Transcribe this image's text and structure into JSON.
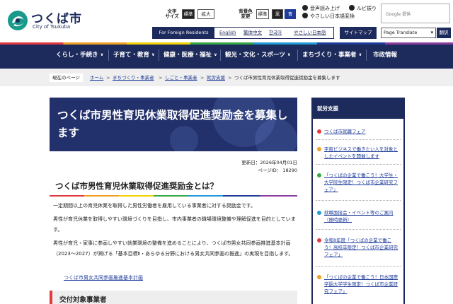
{
  "header": {
    "logo_ja": "つくば市",
    "logo_en": "City of Tsukuba",
    "text_size_label_1": "文字",
    "text_size_label_2": "サイズ",
    "text_size_standard": "標準",
    "text_size_large": "拡大",
    "bg_color_label_1": "背景色",
    "bg_color_label_2": "変更",
    "bg_color_standard": "標準",
    "bg_color_black": "黒",
    "bg_color_blue": "青",
    "read_aloud": "音声読み上げ",
    "ruby": "ルビ振り",
    "easy_japanese": "やさしい日本語変換",
    "search_placeholder": "Google 提供",
    "foreign_residents": "For Foreign Residents",
    "lang_english": "English",
    "lang_chinese_trad": "繁体中文",
    "lang_korean": "한국어",
    "lang_easy_japanese": "やさしい日本語",
    "sitemap": "サイトマップ",
    "page_translate": "Page Translate",
    "translate_button": "翻訳"
  },
  "colors": {
    "navy": "#1d2a5c",
    "red": "#e2393f",
    "orange": "#f0a020",
    "yellow": "#f2d200",
    "green": "#35a843",
    "cyan": "#1f9bd7",
    "blue": "#1f3c99",
    "purple": "#8a3fa0"
  },
  "gnav": {
    "items": [
      {
        "label": "くらし・手続き"
      },
      {
        "label": "子育て・教育"
      },
      {
        "label": "健康・医療・福祉"
      },
      {
        "label": "観光・文化・スポーツ"
      },
      {
        "label": "まちづくり・事業者"
      },
      {
        "label": "市政情報"
      }
    ]
  },
  "breadcrumb": {
    "label": "現在のページ",
    "items": [
      "ホーム",
      "まちづくり・事業者",
      "しごと・事業者",
      "就労支援"
    ],
    "current": "つくば市男性育児休業取得促進奨励金を募集します",
    "separator": ">"
  },
  "main": {
    "title": "つくば市男性育児休業取得促進奨励金を募集します",
    "updated": "更新日：2026年04月01日",
    "page_id": "ページID： 18290",
    "heading": "つくば市男性育児休業取得促進奨励金とは？",
    "para1": "一定期間以上の育児休業を取得した男性労働者を雇用している事業者に対する奨励金です。",
    "para2": "男性が育児休業を取得しやすい環境づくりを目指し、市内事業者の職場環境整備や理解促進を目的としています。",
    "para3": "男性が育児・家事に参画しやすい就業環境の整備を進めることにより、つくば市男女共同参画推進基本計画（2023～2027）が掲げる「基本目標Ⅱ・あらゆる分野における男女共同参画の推進」の実現を目指します。",
    "ref_link": "つくば市男女共同参画推進基本計画",
    "subheading": "交付対象事業者"
  },
  "sidebar": {
    "heading": "就労支援",
    "items": [
      "つくば市就職フェア",
      "宇宙ビジネスで働きたい人を対象としたイベントを開催します",
      "「つくばの企業で働こう！大学生・大学院生限定！つくば市企業研究フェア」",
      "就職面接会・イベント等のご案内（随時更新）",
      "令和8年度「つくばの企業で働こう！高校卒限定！つくば市企業研究フェア」",
      "「つくばの企業で働こう！日本国際学園大学学生限定！つくば市企業研究フェア」"
    ]
  }
}
